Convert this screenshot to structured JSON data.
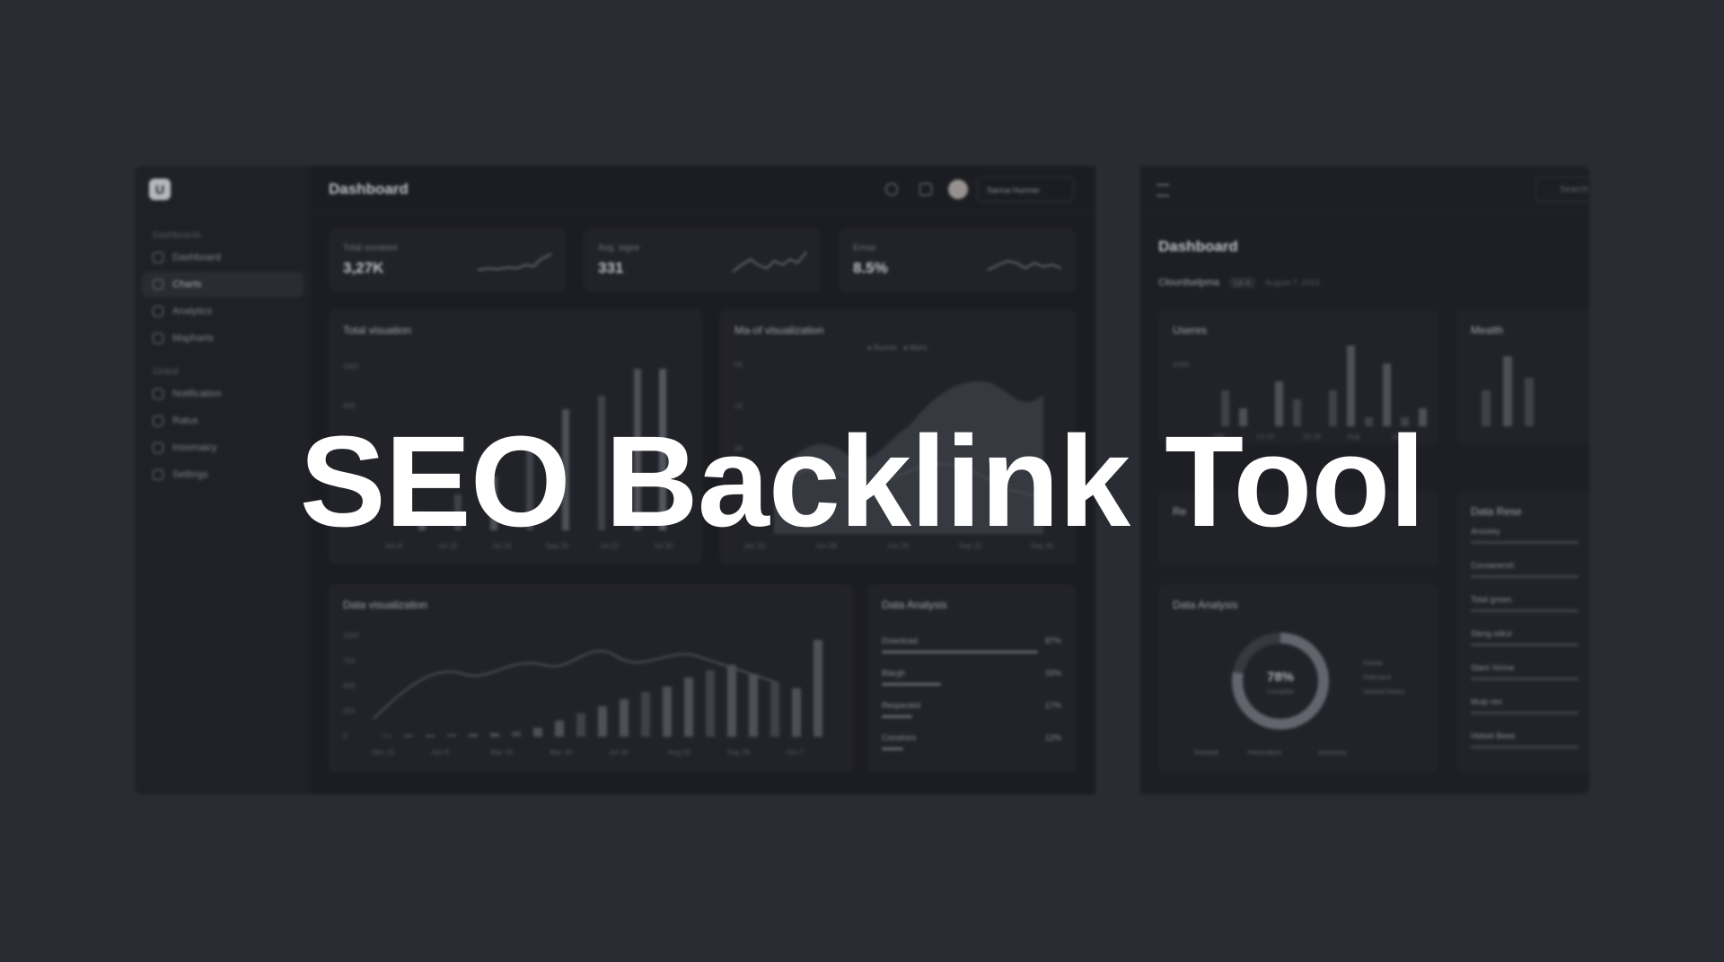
{
  "headline": "SEO Backlink Tool",
  "colors": {
    "background": "#2a2c33",
    "panel": "#1c1d22",
    "card": "#212228",
    "bar": "#55575f",
    "text": "#ffffff"
  },
  "app": {
    "logo_letter": "U",
    "sidebar": {
      "group1": "Dashboards",
      "items1": [
        {
          "label": "Dashboard",
          "icon": "grid-icon"
        },
        {
          "label": "Charts",
          "icon": "bar-chart-icon"
        },
        {
          "label": "Analytics",
          "icon": "trend-icon"
        },
        {
          "label": "Mapharts",
          "icon": "map-icon"
        }
      ],
      "group2": "Global",
      "items2": [
        {
          "label": "Notification",
          "icon": "bell-icon"
        },
        {
          "label": "Ratus",
          "icon": "clock-icon"
        },
        {
          "label": "Insomaicy",
          "icon": "box-icon"
        },
        {
          "label": "Settings",
          "icon": "gear-icon"
        }
      ]
    },
    "topbar": {
      "title": "Dashboard",
      "user": "Sanna Hurrner"
    },
    "kpis": [
      {
        "label": "Total sceasee",
        "value": "3,27K"
      },
      {
        "label": "Avg. sigee",
        "value": "331"
      },
      {
        "label": "Emse",
        "value": "8.5%"
      }
    ],
    "cards": {
      "total_vis": "Total visuation",
      "mix_vis": "Ma-of visualization",
      "mix_legend": [
        "Runner",
        "Maris"
      ],
      "data_vis": "Data visualization",
      "data_analysis": "Data Analysis",
      "analysis_rows": [
        {
          "label": "Download",
          "pct": "87%",
          "value": 0.87
        },
        {
          "label": "Blargh",
          "pct": "33%",
          "value": 0.33
        },
        {
          "label": "Respected",
          "pct": "17%",
          "value": 0.17
        },
        {
          "label": "Conslrors",
          "pct": "12%",
          "value": 0.12
        }
      ]
    },
    "chart_axes": {
      "total_y": [
        "1000",
        "500"
      ],
      "total_x": [
        "Jan 8",
        "Jul 15",
        "Jul 18",
        "Sep 25",
        "Jul 22",
        "Jul 30"
      ],
      "mix_y": [
        "5K",
        "1K",
        "0K"
      ],
      "mix_x": [
        "Jan 20",
        "Jun 08",
        "Jun 26",
        "Sep 22",
        "Sep 30"
      ],
      "data_y": [
        "1000",
        "750",
        "500",
        "250",
        "0"
      ],
      "data_x": [
        "Dec 15",
        "Jan 8",
        "Mar 15",
        "Mar 16",
        "Jul 18",
        "Aug 20",
        "Sep 25",
        "Oct 7"
      ]
    }
  },
  "app2": {
    "search_placeholder": "Search",
    "title": "Dashboard",
    "sub_label": "Clourdselpma",
    "sub_badge": "Lk 4",
    "sub_date": "August 7, 2023",
    "users_title": "Useres",
    "users_y": "1000",
    "users_x": [
      "Ja8",
      "Lil 15",
      "Jul 16",
      "Aug",
      "Jul 30"
    ],
    "wealth_title": "Mealth",
    "revenue_title": "Re",
    "data_analysis": "Data Analysis",
    "donut_value": "78%",
    "donut_label": "Complete",
    "donut_fraction": 0.78,
    "donut_legend": [
      "Rastlar",
      "Potentace",
      "Vestred Distics"
    ],
    "donut_bottom": [
      "Pewledd",
      "Presentkent",
      "Conserew"
    ],
    "data_research": "Data Rese",
    "research_items": [
      "Arsceey",
      "Consanersh",
      "Total grows",
      "Sleng wikul",
      "Stanr hinme",
      "Mulp ren",
      "Hideet Beee"
    ]
  }
}
